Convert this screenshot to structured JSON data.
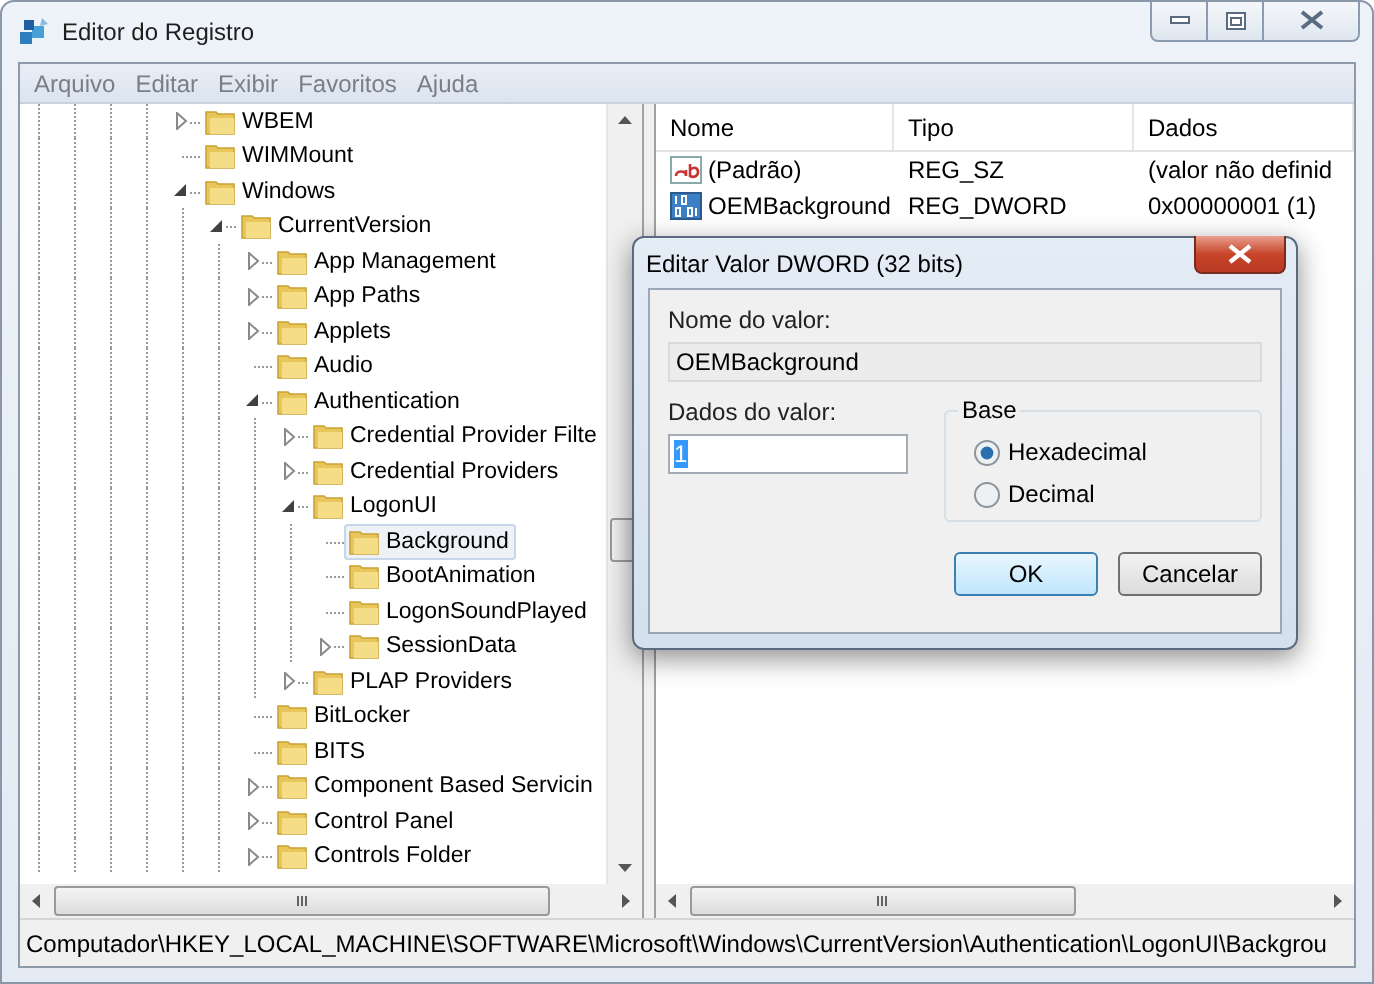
{
  "window": {
    "title": "Editor do Registro"
  },
  "menu": [
    {
      "label": "Arquivo"
    },
    {
      "label": "Editar"
    },
    {
      "label": "Exibir"
    },
    {
      "label": "Favoritos"
    },
    {
      "label": "Ajuda"
    }
  ],
  "tree": [
    {
      "label": "WBEM",
      "has_children": true,
      "expanded": false,
      "selected": false
    },
    {
      "label": "WIMMount",
      "has_children": false,
      "selected": false
    },
    {
      "label": "Windows",
      "has_children": true,
      "expanded": true,
      "selected": false,
      "children": [
        {
          "label": "CurrentVersion",
          "has_children": true,
          "expanded": true,
          "selected": false,
          "children": [
            {
              "label": "App Management",
              "has_children": true,
              "expanded": false,
              "selected": false
            },
            {
              "label": "App Paths",
              "has_children": true,
              "expanded": false,
              "selected": false
            },
            {
              "label": "Applets",
              "has_children": true,
              "expanded": false,
              "selected": false
            },
            {
              "label": "Audio",
              "has_children": false,
              "selected": false
            },
            {
              "label": "Authentication",
              "has_children": true,
              "expanded": true,
              "selected": false,
              "children": [
                {
                  "label": "Credential Provider Filte",
                  "has_children": true,
                  "expanded": false,
                  "selected": false
                },
                {
                  "label": "Credential Providers",
                  "has_children": true,
                  "expanded": false,
                  "selected": false
                },
                {
                  "label": "LogonUI",
                  "has_children": true,
                  "expanded": true,
                  "selected": false,
                  "children": [
                    {
                      "label": "Background",
                      "has_children": false,
                      "selected": true
                    },
                    {
                      "label": "BootAnimation",
                      "has_children": false,
                      "selected": false
                    },
                    {
                      "label": "LogonSoundPlayed",
                      "has_children": false,
                      "selected": false
                    },
                    {
                      "label": "SessionData",
                      "has_children": true,
                      "expanded": false,
                      "selected": false
                    }
                  ]
                },
                {
                  "label": "PLAP Providers",
                  "has_children": true,
                  "expanded": false,
                  "selected": false
                }
              ]
            },
            {
              "label": "BitLocker",
              "has_children": false,
              "selected": false
            },
            {
              "label": "BITS",
              "has_children": false,
              "selected": false
            },
            {
              "label": "Component Based Servicin",
              "has_children": true,
              "expanded": false,
              "selected": false
            },
            {
              "label": "Control Panel",
              "has_children": true,
              "expanded": false,
              "selected": false
            },
            {
              "label": "Controls Folder",
              "has_children": true,
              "expanded": false,
              "selected": false
            }
          ]
        }
      ]
    }
  ],
  "values": {
    "columns": [
      "Nome",
      "Tipo",
      "Dados"
    ],
    "rows": [
      {
        "kind": "string",
        "name": "(Padrão)",
        "type": "REG_SZ",
        "data": "(valor não definid"
      },
      {
        "kind": "binary",
        "name": "OEMBackground",
        "type": "REG_DWORD",
        "data": "0x00000001 (1)"
      }
    ]
  },
  "status_bar": "Computador\\HKEY_LOCAL_MACHINE\\SOFTWARE\\Microsoft\\Windows\\CurrentVersion\\Authentication\\LogonUI\\Backgrou",
  "dialog": {
    "title": "Editar Valor DWORD (32 bits)",
    "name_label": "Nome do valor:",
    "name_value": "OEMBackground",
    "data_label": "Dados do valor:",
    "data_value": "1",
    "data_value_selected": true,
    "base_label": "Base",
    "radios": [
      {
        "label": "Hexadecimal",
        "selected": true
      },
      {
        "label": "Decimal",
        "selected": false
      }
    ],
    "buttons": [
      {
        "label": "OK",
        "default": true
      },
      {
        "label": "Cancelar",
        "default": false
      }
    ]
  }
}
